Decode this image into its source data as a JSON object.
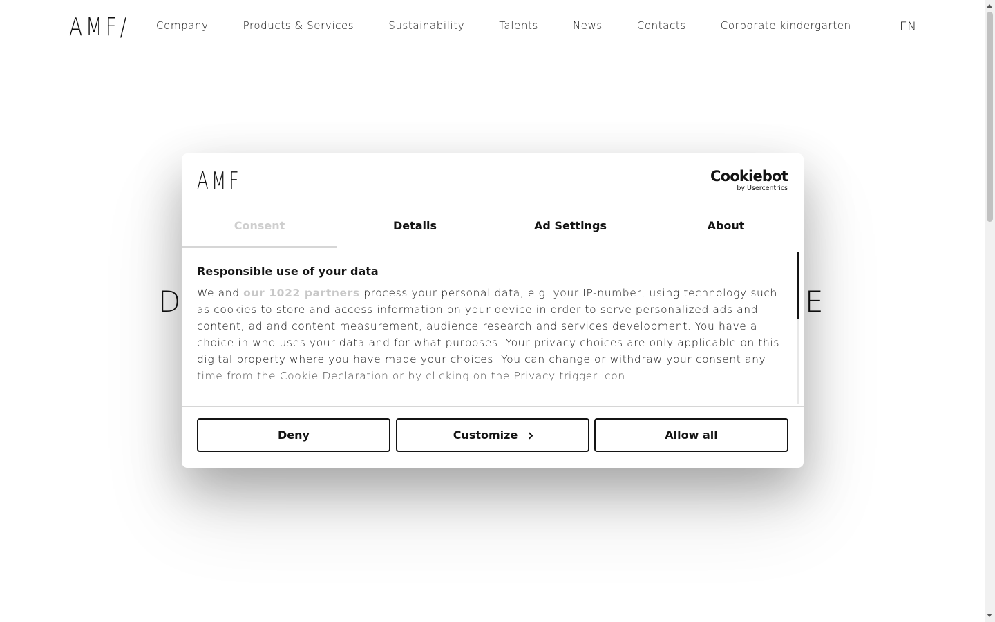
{
  "header": {
    "logo": "AMF/",
    "nav": [
      "Company",
      "Products & Services",
      "Sustainability",
      "Talents",
      "News",
      "Contacts",
      "Corporate kindergarten"
    ],
    "language": "EN"
  },
  "hero": {
    "left_letter": "D",
    "right_letter": "E"
  },
  "cookie_dialog": {
    "logo": "AMF",
    "brand_name": "Cookiebot",
    "brand_sub": "by Usercentrics",
    "tabs": [
      "Consent",
      "Details",
      "Ad Settings",
      "About"
    ],
    "active_tab": "Consent",
    "title": "Responsible use of your data",
    "body_prefix": "We and ",
    "partners_link": "our 1022 partners",
    "body_suffix": " process your personal data, e.g. your IP-number, using technology such as cookies to store and access information on your device in order to serve personalized ads and content, ad and content measurement, audience research and services development. You have a choice in who uses your data and for what purposes. Your privacy choices are only applicable on this digital property where you have made your choices. You can change or withdraw your consent any time from the Cookie Declaration or by clicking on the Privacy trigger icon.",
    "buttons": {
      "deny": "Deny",
      "customize": "Customize",
      "allow_all": "Allow all"
    }
  },
  "colors": {
    "text": "#141414",
    "muted": "#c8c8c8",
    "divider": "#d6d6d6",
    "background": "#ffffff"
  }
}
